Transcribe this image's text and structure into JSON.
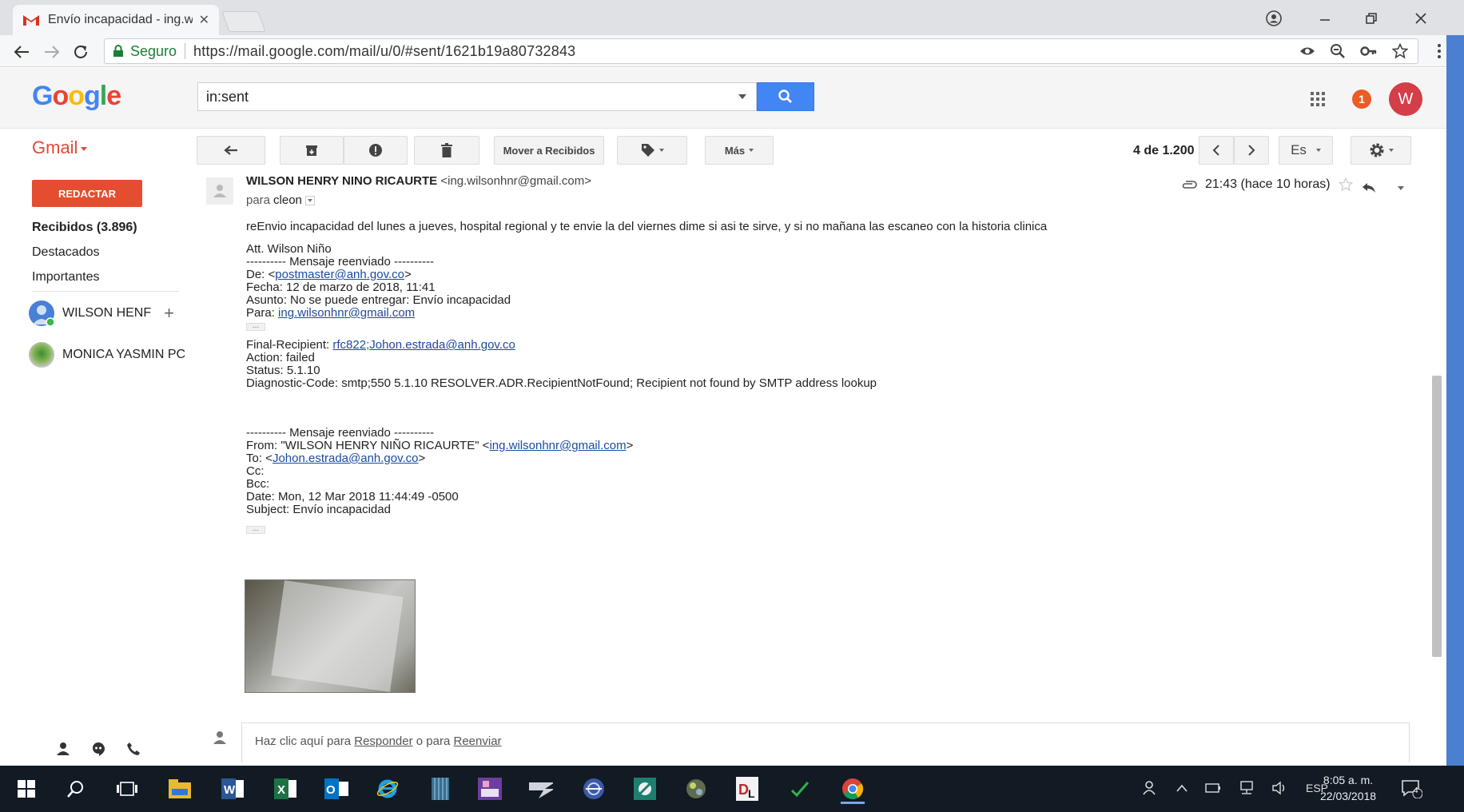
{
  "browser": {
    "tab_title": "Envío incapacidad - ing.w",
    "secure_label": "Seguro",
    "url": "https://mail.google.com/mail/u/0/#sent/1621b19a80732843"
  },
  "gmail": {
    "logo": "Google",
    "label": "Gmail",
    "search_value": "in:sent",
    "notification_count": "1",
    "avatar_letter": "W"
  },
  "toolbar": {
    "move_to_inbox": "Mover a Recibidos",
    "more": "Más",
    "page_count": "4 de 1.200",
    "language": "Es"
  },
  "sidebar": {
    "compose": "REDACTAR",
    "items": [
      {
        "label": "Recibidos (3.896)"
      },
      {
        "label": "Destacados"
      },
      {
        "label": "Importantes"
      }
    ],
    "contacts": [
      {
        "name": "WILSON HENF"
      },
      {
        "name": "MONICA YASMIN PC"
      }
    ]
  },
  "message": {
    "sender_name": "WILSON HENRY NINO RICAURTE",
    "sender_email": "<ing.wilsonhnr@gmail.com>",
    "to_prefix": "para",
    "to_name": "cleon",
    "time": "21:43 (hace 10 horas)",
    "body_intro": "reEnvio incapacidad del lunes a jueves, hospital regional y te envie la del viernes dime si asi te sirve, y si no mañana las escaneo con la historia clinica",
    "signature": "Att. Wilson Niño",
    "fwd1": {
      "header": "---------- Mensaje reenviado ----------",
      "from_prefix": "De: <",
      "from_link": "postmaster@anh.gov.co",
      "from_suffix": ">",
      "date": "Fecha: 12 de marzo de 2018, 11:41",
      "subject": "Asunto: No se puede entregar: Envío incapacidad",
      "to_prefix": "Para: ",
      "to_link": "ing.wilsonhnr@gmail.com"
    },
    "delivery": {
      "final_prefix": "Final-Recipient: ",
      "final_link": "rfc822;Johon.estrada@anh.gov.co",
      "action": "Action: failed",
      "status": "Status: 5.1.10",
      "diagnostic": "Diagnostic-Code: smtp;550 5.1.10 RESOLVER.ADR.RecipientNotFound; Recipient not found by SMTP address lookup"
    },
    "fwd2": {
      "header": "---------- Mensaje reenviado ----------",
      "from_prefix": "From: \"WILSON HENRY NIÑO RICAURTE\" <",
      "from_link": "ing.wilsonhnr@gmail.com",
      "from_suffix": ">",
      "to_prefix": "To: <",
      "to_link": "Johon.estrada@anh.gov.co",
      "to_suffix": ">",
      "cc": "Cc:",
      "bcc": "Bcc:",
      "date": "Date: Mon, 12 Mar 2018 11:44:49 -0500",
      "subject": "Subject: Envío incapacidad"
    },
    "dots": "..."
  },
  "reply": {
    "prefix": "Haz clic aquí para ",
    "reply_link": "Responder",
    "middle": " o para ",
    "forward_link": "Reenviar"
  },
  "taskbar": {
    "language": "ESP",
    "time": "8:05 a. m.",
    "date": "22/03/2018",
    "notification_badge": "4"
  },
  "colors": {
    "gmail_red": "#dd4b39",
    "compose_red": "#e44d2f",
    "search_blue": "#4285f4",
    "link_blue": "#1a4ba0",
    "taskbar": "#121a24"
  }
}
